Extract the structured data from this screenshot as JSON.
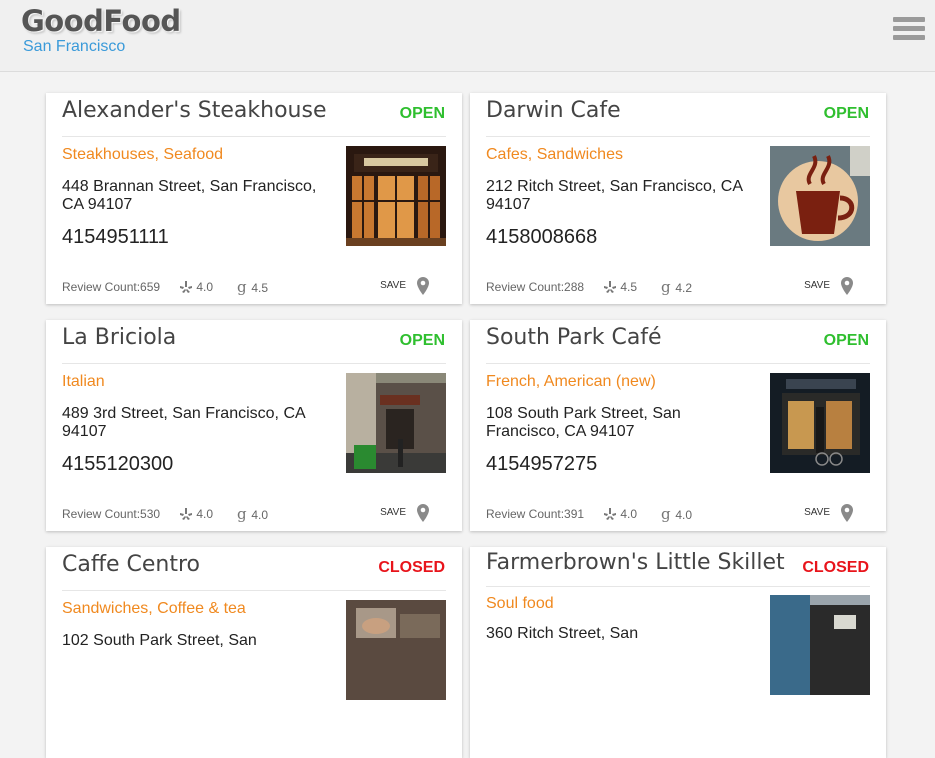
{
  "app": {
    "brand": "GoodFood",
    "city": "San Francisco"
  },
  "restaurants": [
    {
      "name": "Alexander's Steakhouse",
      "status": "OPEN",
      "categories": "Steakhouses, Seafood",
      "address": "448 Brannan Street, San Francisco, CA 94107",
      "phone": "4154951111",
      "review_count": "Review Count:659",
      "yelp_rating": "4.0",
      "google_rating": "4.5",
      "save_label": "SAVE"
    },
    {
      "name": "Darwin Cafe",
      "status": "OPEN",
      "categories": "Cafes, Sandwiches",
      "address": "212 Ritch Street, San Francisco, CA 94107",
      "phone": "4158008668",
      "review_count": "Review Count:288",
      "yelp_rating": "4.5",
      "google_rating": "4.2",
      "save_label": "SAVE"
    },
    {
      "name": "La Briciola",
      "status": "OPEN",
      "categories": "Italian",
      "address": "489 3rd Street, San Francisco, CA 94107",
      "phone": "4155120300",
      "review_count": "Review Count:530",
      "yelp_rating": "4.0",
      "google_rating": "4.0",
      "save_label": "SAVE"
    },
    {
      "name": "South Park Café",
      "status": "OPEN",
      "categories": "French, American (new)",
      "address": "108 South Park Street, San Francisco, CA 94107",
      "phone": "4154957275",
      "review_count": "Review Count:391",
      "yelp_rating": "4.0",
      "google_rating": "4.0",
      "save_label": "SAVE"
    },
    {
      "name": "Caffe Centro",
      "status": "CLOSED",
      "categories": "Sandwiches, Coffee & tea",
      "address": "102 South Park Street, San",
      "phone": "",
      "review_count": "",
      "yelp_rating": "",
      "google_rating": "",
      "save_label": ""
    },
    {
      "name": "Farmerbrown's Little Skillet",
      "status": "CLOSED",
      "categories": "Soul food",
      "address": "360 Ritch Street, San",
      "phone": "",
      "review_count": "",
      "yelp_rating": "",
      "google_rating": "",
      "save_label": ""
    }
  ],
  "colors": {
    "open": "#2fbf2f",
    "closed": "#e8141b",
    "category": "#f0891f",
    "city": "#3a9ad9"
  },
  "icons": {
    "menu": "hamburger-menu-icon",
    "yelp": "yelp-icon",
    "google": "google-icon",
    "pin": "map-pin-icon"
  }
}
